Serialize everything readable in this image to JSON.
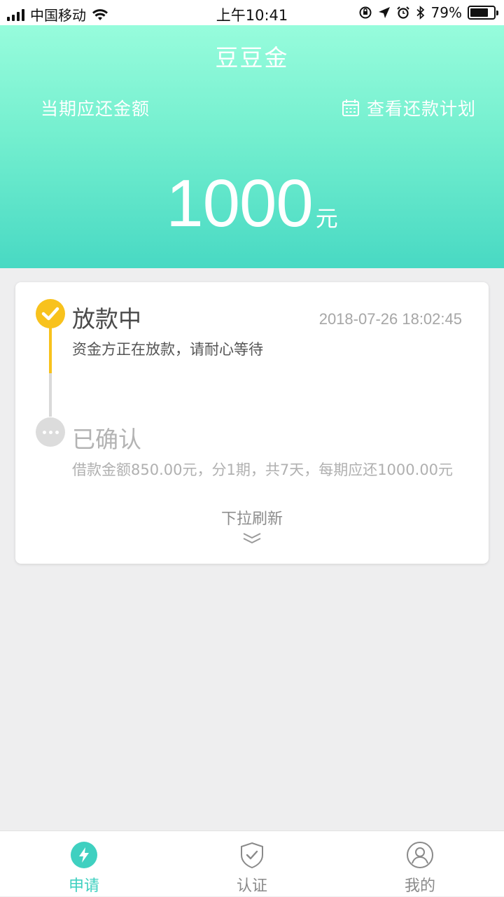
{
  "status_bar": {
    "carrier": "中国移动",
    "time": "上午10:41",
    "battery_pct": "79%",
    "battery_level": 0.79
  },
  "header": {
    "title": "豆豆金",
    "due_label": "当期应还金额",
    "plan_link": "查看还款计划",
    "amount": "1000",
    "unit": "元"
  },
  "progress": {
    "steps": [
      {
        "title": "放款中",
        "time": "2018-07-26 18:02:45",
        "desc": "资金方正在放款，请耐心等待",
        "state": "active",
        "color": "#f8c21d"
      },
      {
        "title": "已确认",
        "desc": "借款金额850.00元，分1期，共7天，每期应还1000.00元",
        "state": "done",
        "color": "#dcdcdc"
      }
    ],
    "pull_hint": "下拉刷新"
  },
  "tabbar": {
    "tabs": [
      {
        "label": "申请",
        "icon": "lightning-icon",
        "active": true
      },
      {
        "label": "认证",
        "icon": "shield-check-icon",
        "active": false
      },
      {
        "label": "我的",
        "icon": "user-icon",
        "active": false
      }
    ],
    "active_color": "#3fd0c0",
    "inactive_color": "#8a8a8a"
  },
  "colors": {
    "header_gradient_top": "#97fcdc",
    "header_gradient_bottom": "#48d9c3",
    "background": "#eeeeef"
  }
}
